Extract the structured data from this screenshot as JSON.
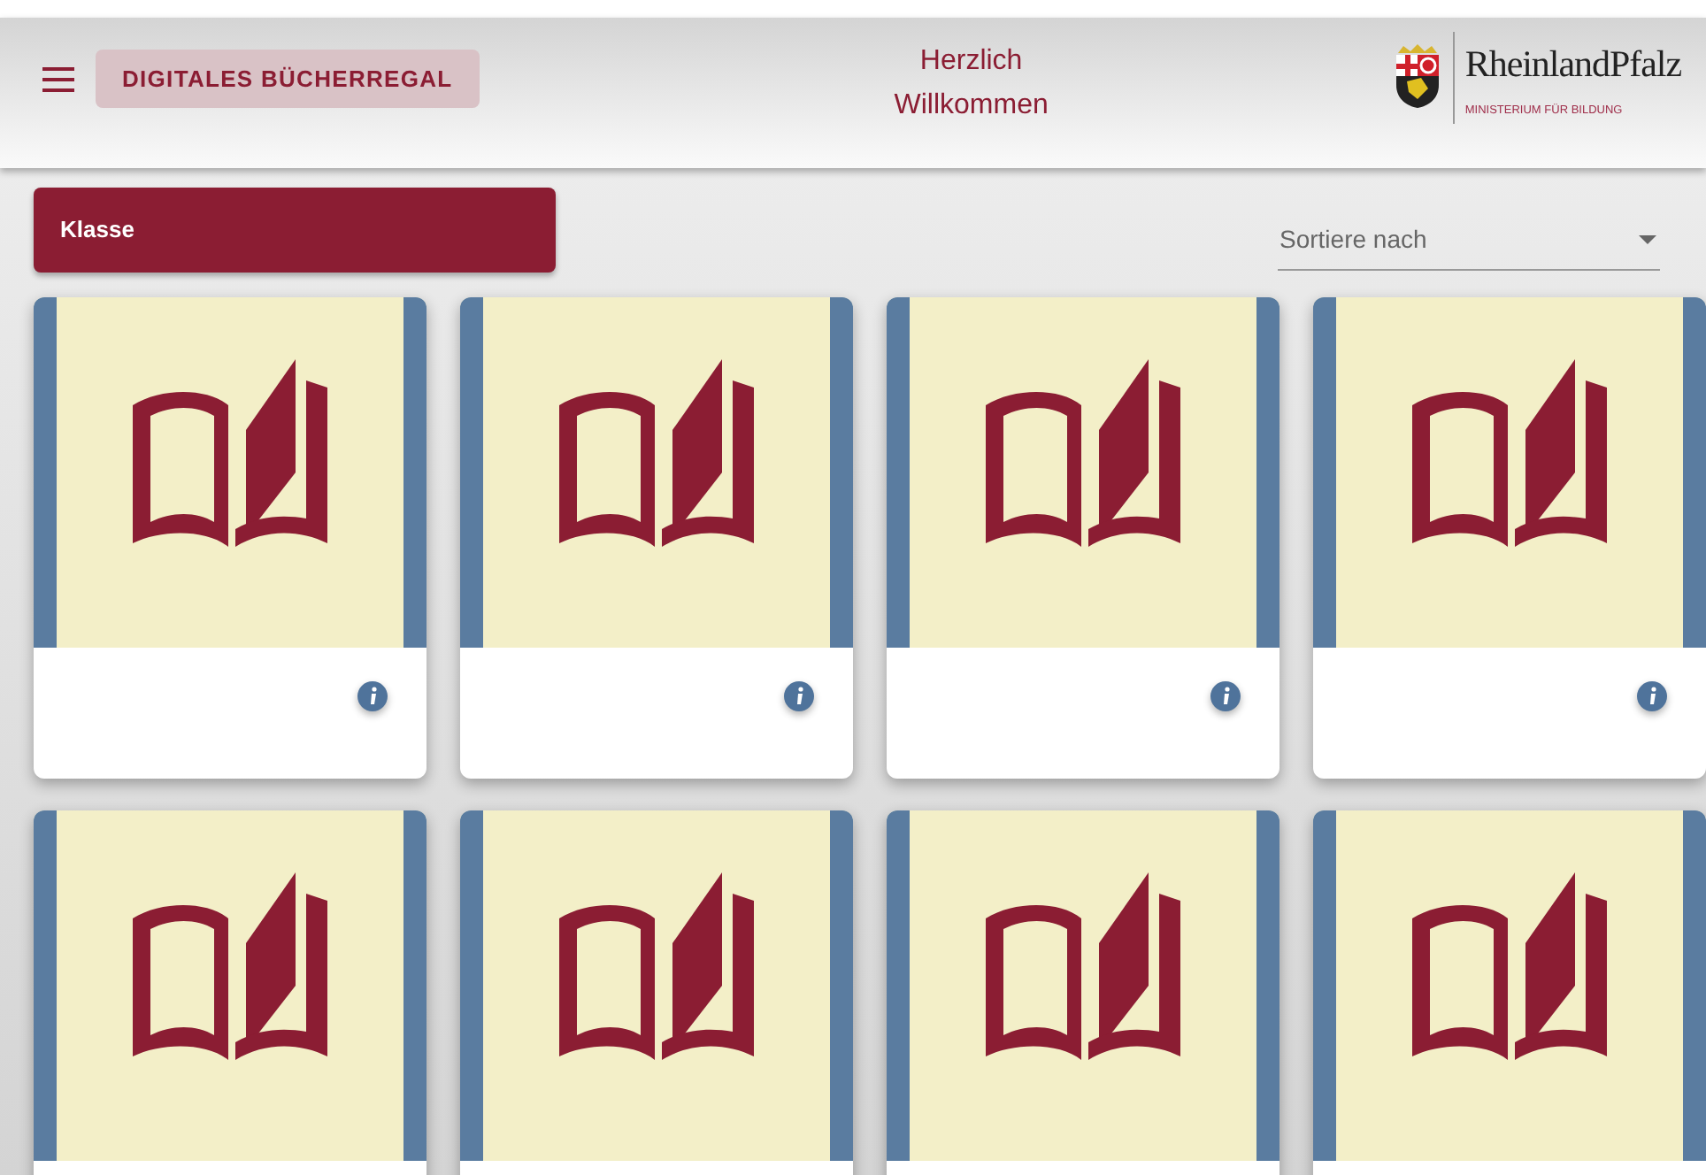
{
  "header": {
    "app_title": "DIGITALES BÜCHERREGAL",
    "greeting": "Herzlich Willkommen",
    "logo": {
      "name": "RheinlandPfalz",
      "subtitle": "MINISTERIUM FÜR BILDUNG"
    }
  },
  "toolbar": {
    "class_button": "Klasse",
    "sort": {
      "placeholder": "Sortiere nach"
    }
  },
  "books": [
    {
      "kind": "book"
    },
    {
      "kind": "book"
    },
    {
      "kind": "book"
    },
    {
      "kind": "book"
    },
    {
      "kind": "book"
    },
    {
      "kind": "book"
    },
    {
      "kind": "book"
    },
    {
      "kind": "book"
    }
  ]
}
